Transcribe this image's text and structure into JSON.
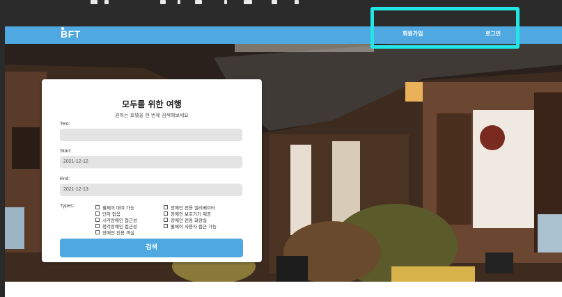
{
  "nav": {
    "logo": "BFT",
    "signup_label": "회원가입",
    "login_label": "로그인"
  },
  "search": {
    "title": "모두를 위한 여행",
    "subtitle": "원하는 호텔을 한 번에 검색해보세요",
    "text_label": "Text:",
    "text_value": "",
    "start_label": "Start:",
    "start_value": "2021-12-12",
    "end_label": "End:",
    "end_value": "2021-12-13",
    "types_label": "Types:",
    "types": [
      "휠체어 대여 가능",
      "단차 없음",
      "시각장애인 접근성",
      "청각장애인 접근성",
      "장애인 전용 객실",
      "장애인 전용 엘리베이터",
      "장애인 보호기기 제공",
      "장애인 전용 화장실",
      "휠체어 사용자 접근 가능"
    ],
    "button_label": "검색"
  },
  "colors": {
    "nav_bg": "#4fa8df",
    "button_bg": "#4fa8df",
    "highlight": "#22e6e6"
  }
}
